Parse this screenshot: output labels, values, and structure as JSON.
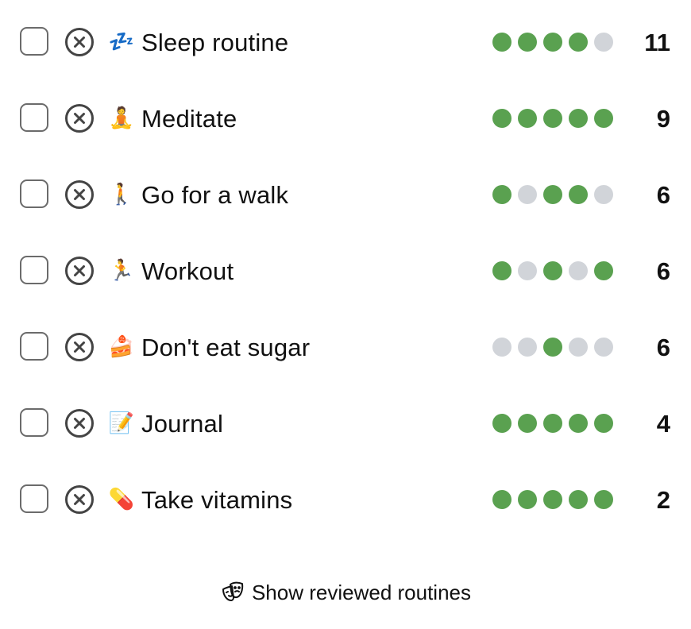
{
  "routines": [
    {
      "emoji": "💤",
      "icon": "zzz-icon",
      "label": "Sleep routine",
      "streak": [
        1,
        1,
        1,
        1,
        0
      ],
      "count": "11"
    },
    {
      "emoji": "🧘",
      "icon": "person-meditating-icon",
      "label": "Meditate",
      "streak": [
        1,
        1,
        1,
        1,
        1
      ],
      "count": "9"
    },
    {
      "emoji": "🚶",
      "icon": "person-walking-icon",
      "label": "Go for a walk",
      "streak": [
        1,
        0,
        1,
        1,
        0
      ],
      "count": "6"
    },
    {
      "emoji": "🏃",
      "icon": "person-running-icon",
      "label": "Workout",
      "streak": [
        1,
        0,
        1,
        0,
        1
      ],
      "count": "6"
    },
    {
      "emoji": "🍰",
      "icon": "cake-slice-icon",
      "label": "Don't eat sugar",
      "streak": [
        0,
        0,
        1,
        0,
        0
      ],
      "count": "6"
    },
    {
      "emoji": "📝",
      "icon": "memo-pencil-icon",
      "label": "Journal",
      "streak": [
        1,
        1,
        1,
        1,
        1
      ],
      "count": "4"
    },
    {
      "emoji": "💊",
      "icon": "pill-icon",
      "label": "Take vitamins",
      "streak": [
        1,
        1,
        1,
        1,
        1
      ],
      "count": "2"
    }
  ],
  "footer": {
    "show_reviewed_label": "Show reviewed routines",
    "icon": "theater-masks-icon"
  },
  "colors": {
    "done": "#5aa150",
    "missed": "#d1d4d9",
    "border": "#6b6b6b"
  }
}
